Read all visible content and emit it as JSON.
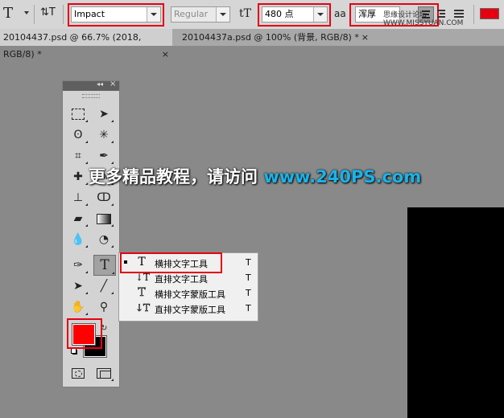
{
  "options_bar": {
    "type_tool_glyph": "T",
    "orientation_glyph": "⇅T",
    "font_family": "Impact",
    "font_style": "Regular",
    "font_size": "480 点",
    "antialias_glyph": "aa",
    "antialias_label": "浑厚",
    "color_swatch": "#e60012",
    "site_watermark": "思缘设计论坛 WWW.MISSYUAN.COM"
  },
  "tabs": [
    {
      "label": "20104437.psd @ 66.7% (2018, RGB/8) *",
      "close": "×"
    },
    {
      "label": "20104437a.psd @ 100% (背景, RGB/8) *",
      "close": "×"
    }
  ],
  "toolbox": {
    "header_glyph": "◂◂",
    "close_glyph": "×",
    "foreground_color": "#ff0000",
    "background_color": "#000000"
  },
  "type_flyout": {
    "items": [
      {
        "icon": "T",
        "label": "横排文字工具",
        "key": "T",
        "selected": true
      },
      {
        "icon": "↓T",
        "label": "直排文字工具",
        "key": "T",
        "selected": false
      },
      {
        "icon": "T",
        "label": "横排文字蒙版工具",
        "key": "T",
        "selected": false
      },
      {
        "icon": "↓T",
        "label": "直排文字蒙版工具",
        "key": "T",
        "selected": false
      }
    ]
  },
  "watermark": {
    "text": "更多精品教程，请访问 ",
    "url": "www.240PS.com"
  },
  "colors": {
    "canvas_bg": "#898989",
    "highlight_red": "#e60012"
  }
}
